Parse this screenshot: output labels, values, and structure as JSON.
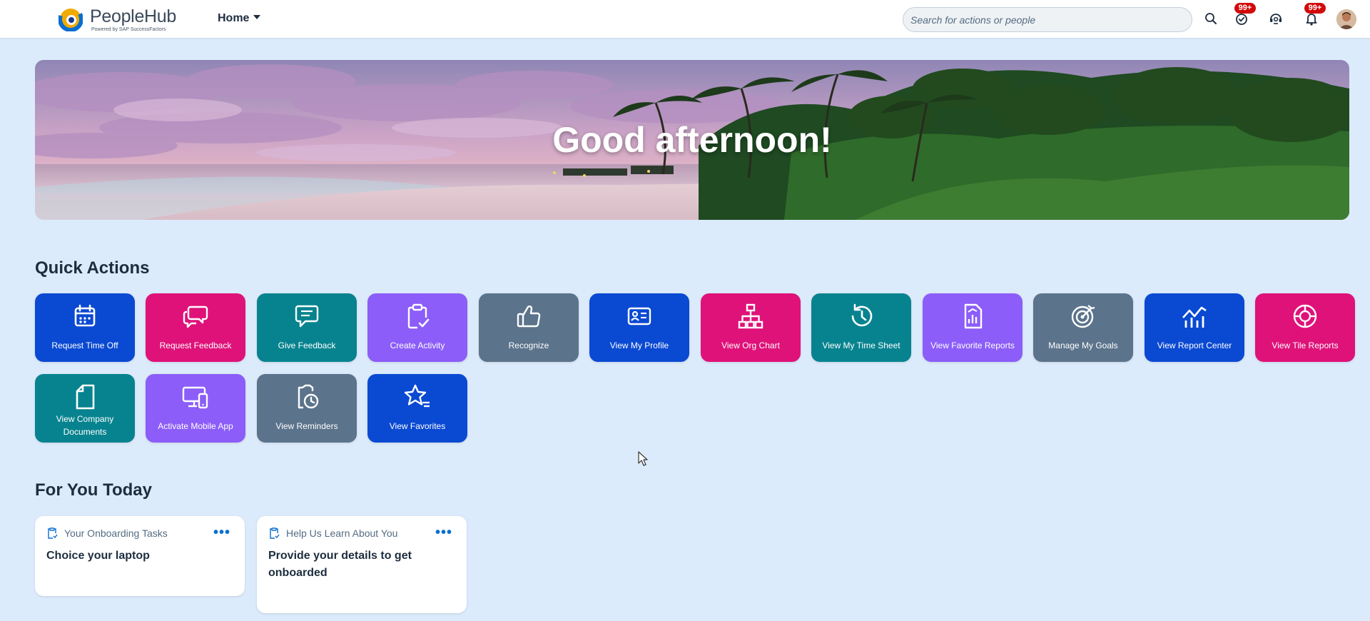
{
  "header": {
    "app_name": "PeopleHub",
    "app_subtitle": "Powered by SAP SuccessFactors",
    "nav_label": "Home",
    "search_placeholder": "Search for actions or people",
    "approvals_badge": "99+",
    "notifications_badge": "99+",
    "icons": [
      "search-icon",
      "approvals-icon",
      "support-icon",
      "bell-icon",
      "avatar"
    ]
  },
  "banner": {
    "greeting": "Good afternoon!"
  },
  "quick_actions": {
    "title": "Quick Actions",
    "tiles": [
      {
        "label": "Request Time Off",
        "icon": "calendar-icon",
        "color": "#0a49d2"
      },
      {
        "label": "Request Feedback",
        "icon": "chat-bubbles-icon",
        "color": "#df1279"
      },
      {
        "label": "Give Feedback",
        "icon": "feedback-icon",
        "color": "#07838f"
      },
      {
        "label": "Create Activity",
        "icon": "clipboard-check-icon",
        "color": "#8c5df8"
      },
      {
        "label": "Recognize",
        "icon": "thumbs-up-icon",
        "color": "#5b738b"
      },
      {
        "label": "View My Profile",
        "icon": "profile-card-icon",
        "color": "#0a49d2"
      },
      {
        "label": "View Org Chart",
        "icon": "org-chart-icon",
        "color": "#df1279"
      },
      {
        "label": "View My Time Sheet",
        "icon": "history-icon",
        "color": "#07838f"
      },
      {
        "label": "View Favorite Reports",
        "icon": "report-icon",
        "color": "#8c5df8"
      },
      {
        "label": "Manage My Goals",
        "icon": "target-icon",
        "color": "#5b738b"
      },
      {
        "label": "View Report Center",
        "icon": "line-chart-icon",
        "color": "#0a49d2"
      },
      {
        "label": "View Tile Reports",
        "icon": "tile-report-icon",
        "color": "#df1279"
      },
      {
        "label": "View Company Documents",
        "icon": "document-icon",
        "color": "#07838f"
      },
      {
        "label": "Activate Mobile App",
        "icon": "mobile-app-icon",
        "color": "#8c5df8"
      },
      {
        "label": "View Reminders",
        "icon": "reminder-icon",
        "color": "#5b738b"
      },
      {
        "label": "View Favorites",
        "icon": "star-list-icon",
        "color": "#0a49d2"
      }
    ]
  },
  "for_you_today": {
    "title": "For You Today",
    "cards": [
      {
        "header": "Your Onboarding Tasks",
        "body": "Choice your laptop",
        "more": "•••"
      },
      {
        "header": "Help Us Learn About You",
        "body": "Provide your details to get onboarded",
        "more": "•••"
      }
    ]
  }
}
